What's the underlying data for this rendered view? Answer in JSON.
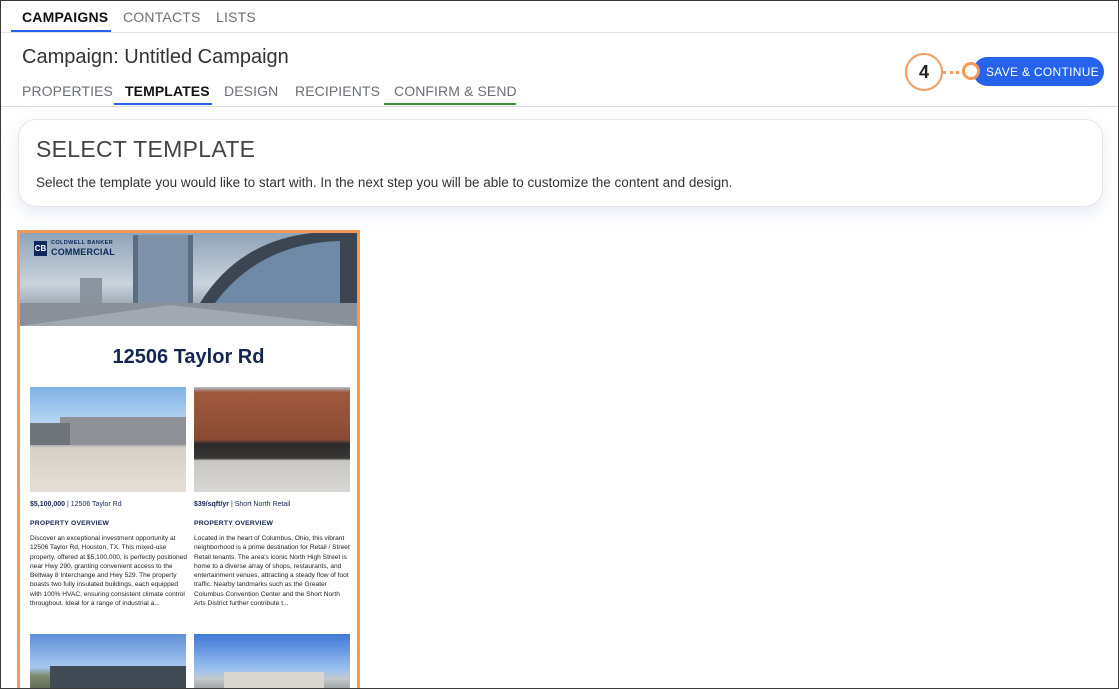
{
  "nav": {
    "tabs": [
      {
        "label": "CAMPAIGNS"
      },
      {
        "label": "CONTACTS"
      },
      {
        "label": "LISTS"
      }
    ]
  },
  "campaign": {
    "title": "Campaign: Untitled Campaign",
    "steps": [
      {
        "label": "PROPERTIES"
      },
      {
        "label": "TEMPLATES"
      },
      {
        "label": "DESIGN"
      },
      {
        "label": "RECIPIENTS"
      },
      {
        "label": "CONFIRM & SEND"
      }
    ],
    "save_label": "SAVE & CONTINUE",
    "callout_number": "4"
  },
  "select_template": {
    "heading": "SELECT TEMPLATE",
    "description": "Select the template you would like to start with. In the next step you will be able to customize the content and design."
  },
  "template": {
    "logo_line1": "COLDWELL BANKER",
    "logo_line2": "COMMERCIAL",
    "logo_mark": "CB",
    "property_title": "12506 Taylor Rd",
    "listings": [
      {
        "price": "$5,100,000",
        "name": "12506 Taylor Rd",
        "overview_label": "PROPERTY OVERVIEW",
        "description": "Discover an exceptional investment opportunity at 12506 Taylor Rd, Houston, TX. This mixed-use property, offered at $5,100,000, is perfectly positioned near Hwy 290, granting convenient access to the Beltway 8 Interchange and Hwy 529. The property boasts two fully insulated buildings, each equipped with 100% HVAC, ensuring consistent climate control throughout. Ideal for a range of industrial a..."
      },
      {
        "price": "$39/sqft/yr",
        "name": "Short North Retail",
        "overview_label": "PROPERTY OVERVIEW",
        "description": "Located in the heart of Columbus, Ohio, this vibrant neighborhood is a prime destination for Retail / Street Retail tenants. The area's iconic North High Street is home to a diverse array of shops, restaurants, and entertainment venues, attracting a steady flow of foot traffic. Nearby landmarks such as the Greater Columbus Convention Center and the Short North Arts District further contribute t..."
      }
    ]
  },
  "colors": {
    "accent_blue": "#2563eb",
    "callout_orange": "#f39a5b",
    "confirm_green": "#3f8f3f",
    "brand_navy": "#14264f"
  }
}
